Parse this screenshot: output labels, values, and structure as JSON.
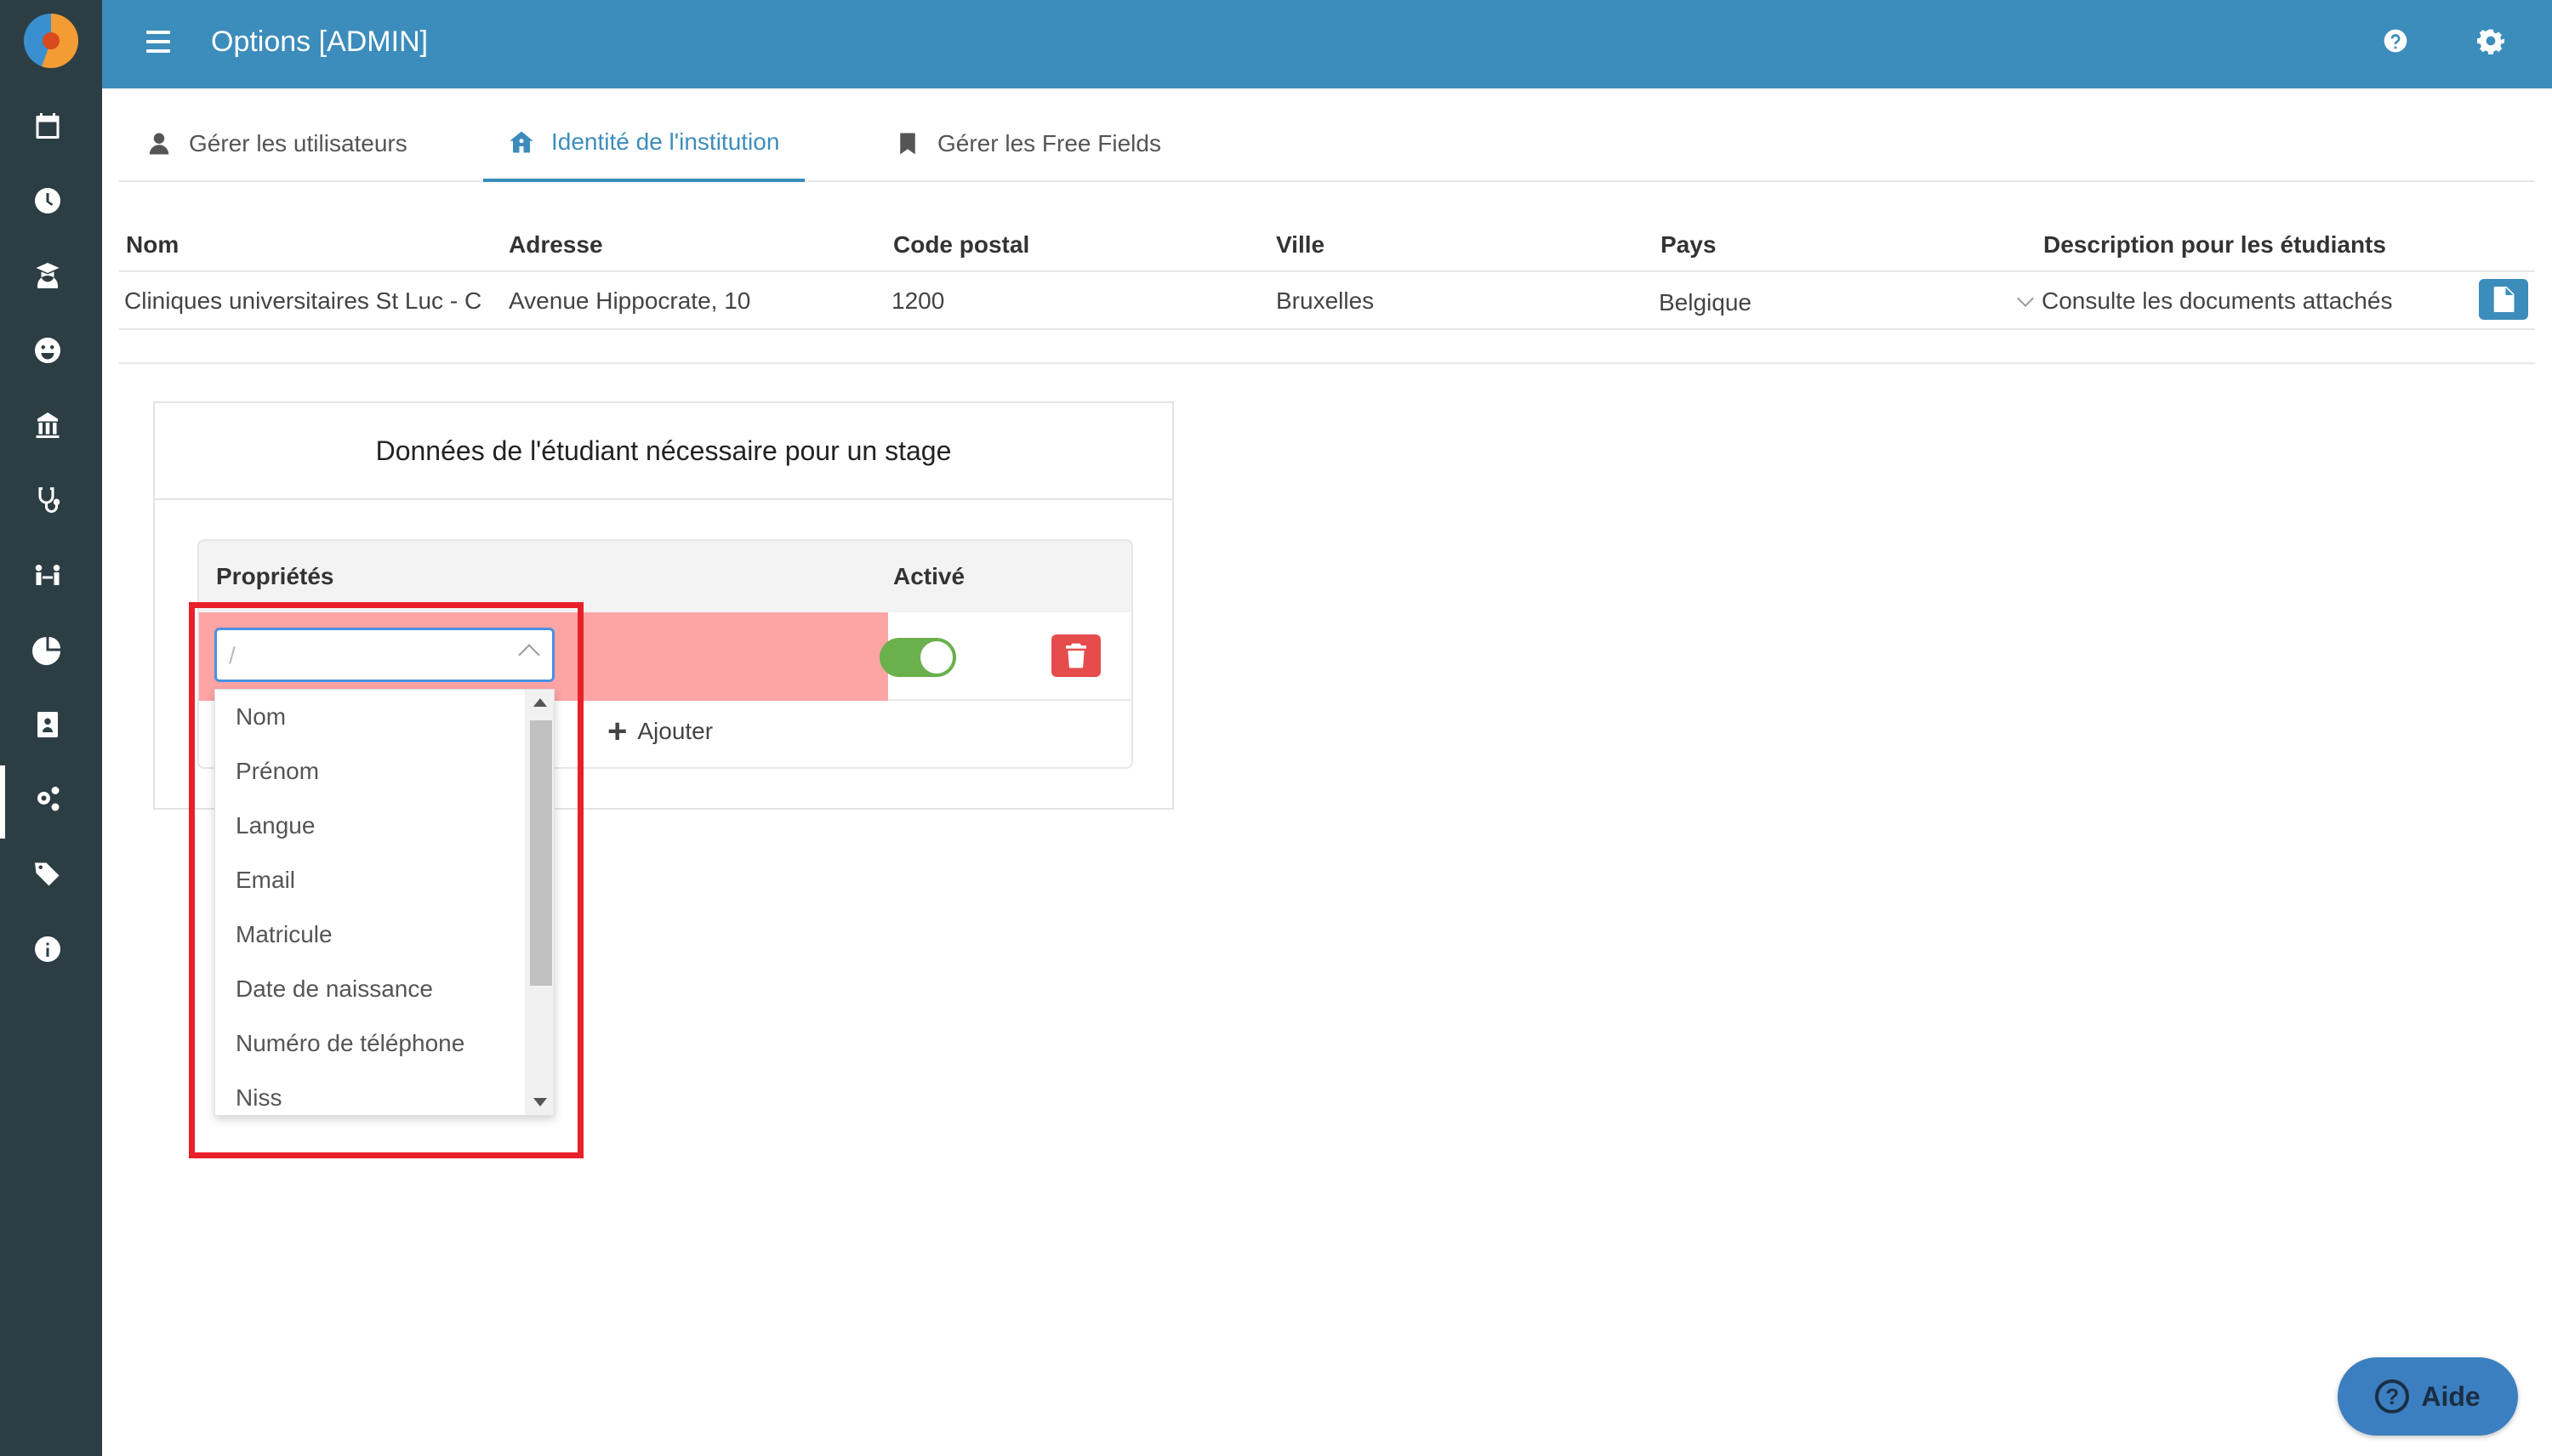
{
  "header": {
    "title": "Options [ADMIN]"
  },
  "tabs": [
    {
      "label": "Gérer les utilisateurs",
      "icon": "user-icon"
    },
    {
      "label": "Identité de l'institution",
      "icon": "home-icon",
      "active": true
    },
    {
      "label": "Gérer les Free Fields",
      "icon": "bookmark-icon"
    }
  ],
  "institution_table": {
    "headers": [
      "Nom",
      "Adresse",
      "Code postal",
      "Ville",
      "Pays",
      "Description pour les étudiants"
    ],
    "row": {
      "nom": "Cliniques universitaires St Luc - Ce",
      "adresse": "Avenue Hippocrate, 10",
      "code_postal": "1200",
      "ville": "Bruxelles",
      "pays": "Belgique",
      "description": "Consulte les documents attachés"
    }
  },
  "panel": {
    "title": "Données de l'étudiant nécessaire pour un stage",
    "headers": {
      "properties": "Propriétés",
      "active": "Activé"
    },
    "select_placeholder": "/",
    "toggle_on": true,
    "add_label": "Ajouter"
  },
  "dropdown_options": [
    "Nom",
    "Prénom",
    "Langue",
    "Email",
    "Matricule",
    "Date de naissance",
    "Numéro de téléphone",
    "Niss"
  ],
  "help_button": {
    "label": "Aide"
  },
  "colors": {
    "header_bg": "#3c8dbc",
    "sidebar_bg": "#2c3e44",
    "accent": "#3c8dbc",
    "error_row": "#fda4a4",
    "toggle_on": "#6ab04c",
    "delete": "#e74c4c",
    "highlight": "#e8202a"
  },
  "sidebar_icons": [
    "calendar-icon",
    "clock-icon",
    "graduate-icon",
    "smiley-icon",
    "institution-icon",
    "stethoscope-icon",
    "people-icon",
    "pie-chart-icon",
    "contact-card-icon",
    "cogs-icon",
    "tags-icon",
    "info-icon"
  ]
}
